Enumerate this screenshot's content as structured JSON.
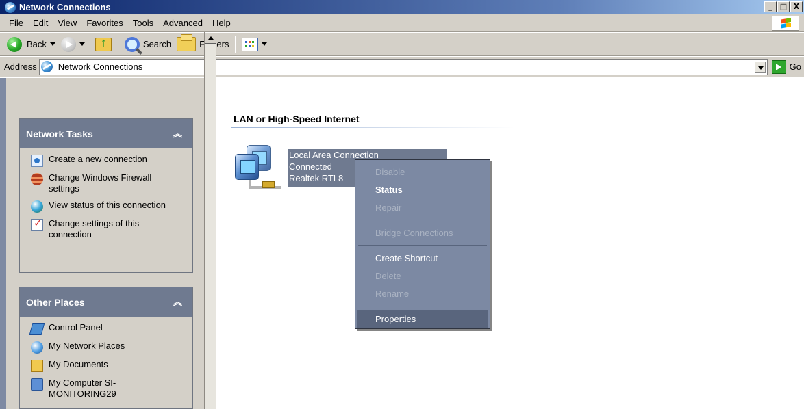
{
  "window": {
    "title": "Network Connections",
    "controls": [
      "_",
      "□",
      "X"
    ]
  },
  "menu": {
    "items": [
      "File",
      "Edit",
      "View",
      "Favorites",
      "Tools",
      "Advanced",
      "Help"
    ]
  },
  "toolbar": {
    "back_label": "Back",
    "search_label": "Search",
    "folders_label": "Folders"
  },
  "address": {
    "label": "Address",
    "value": "Network Connections",
    "go_label": "Go"
  },
  "sidebar": {
    "network_tasks": {
      "title": "Network Tasks",
      "collapse_icon": "chevron-up-double",
      "items": [
        "Create a new connection",
        "Change Windows Firewall settings",
        "View status of this connection",
        "Change settings of this connection"
      ]
    },
    "other_places": {
      "title": "Other Places",
      "collapse_icon": "chevron-up-double",
      "items": [
        "Control Panel",
        "My Network Places",
        "My Documents",
        "My Computer SI-MONITORING29"
      ]
    }
  },
  "content": {
    "section_title": "LAN or High-Speed Internet",
    "connection": {
      "name": "Local Area Connection",
      "status": "Connected",
      "adapter": "Realtek RTL8"
    }
  },
  "context_menu": {
    "items": [
      {
        "label": "Disable",
        "disabled": true
      },
      {
        "label": "Status",
        "disabled": false,
        "bold": true
      },
      {
        "label": "Repair",
        "disabled": true
      },
      {
        "label": "Bridge Connections",
        "disabled": true
      },
      {
        "label": "Create Shortcut",
        "disabled": false
      },
      {
        "label": "Delete",
        "disabled": true
      },
      {
        "label": "Rename",
        "disabled": true
      },
      {
        "label": "Properties",
        "disabled": false,
        "selected": true
      }
    ]
  },
  "icons": {
    "window": "network-connections-icon",
    "back": "back-arrow-icon",
    "forward": "forward-arrow-icon",
    "up": "folder-up-icon",
    "search": "search-icon",
    "folders": "folders-icon",
    "views": "views-icon",
    "go": "go-arrow-icon",
    "local_area_connection": "network-connection-icon"
  }
}
